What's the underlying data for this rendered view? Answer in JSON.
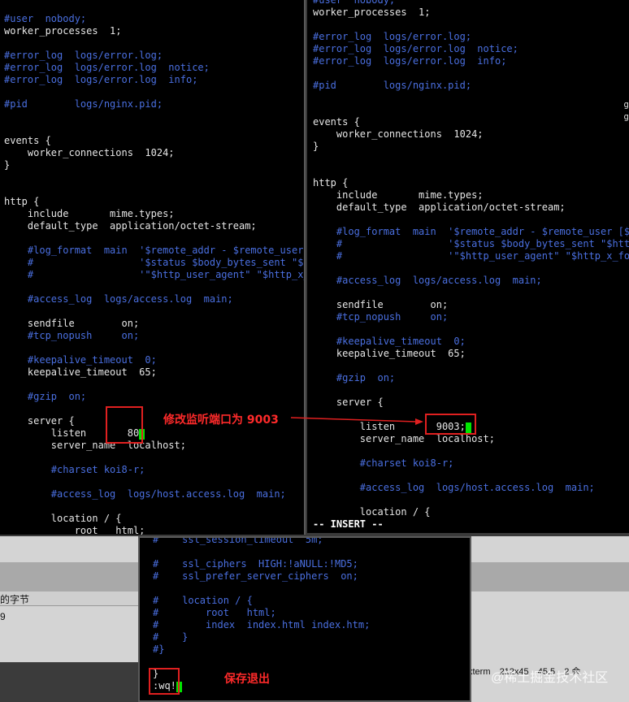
{
  "background": {
    "tab_label": "的字节",
    "tab_value": "9",
    "statusbar": [
      "xterm",
      "212x45",
      "45.5",
      "2 会"
    ],
    "watermark": "@稀土掘金技术社区"
  },
  "left_terminal": {
    "lines": [
      {
        "t": "#user  nobody;",
        "c": true
      },
      {
        "t": "worker_processes  1;"
      },
      {
        "t": ""
      },
      {
        "t": "#error_log  logs/error.log;",
        "c": true
      },
      {
        "t": "#error_log  logs/error.log  notice;",
        "c": true
      },
      {
        "t": "#error_log  logs/error.log  info;",
        "c": true
      },
      {
        "t": ""
      },
      {
        "t": "#pid        logs/nginx.pid;",
        "c": true
      },
      {
        "t": ""
      },
      {
        "t": ""
      },
      {
        "t": "events {"
      },
      {
        "t": "    worker_connections  1024;"
      },
      {
        "t": "}"
      },
      {
        "t": ""
      },
      {
        "t": ""
      },
      {
        "t": "http {"
      },
      {
        "t": "    include       mime.types;"
      },
      {
        "t": "    default_type  application/octet-stream;"
      },
      {
        "t": ""
      },
      {
        "t": "    #log_format  main  '$remote_addr - $remote_user [",
        "c": true
      },
      {
        "t": "    #                  '$status $body_bytes_sent \"$htt",
        "c": true
      },
      {
        "t": "    #                  '\"$http_user_agent\" \"$http_x_f",
        "c": true
      },
      {
        "t": ""
      },
      {
        "t": "    #access_log  logs/access.log  main;",
        "c": true
      },
      {
        "t": ""
      },
      {
        "t": "    sendfile        on;"
      },
      {
        "t": "    #tcp_nopush     on;",
        "c": true
      },
      {
        "t": ""
      },
      {
        "t": "    #keepalive_timeout  0;",
        "c": true
      },
      {
        "t": "    keepalive_timeout  65;"
      },
      {
        "t": ""
      },
      {
        "t": "    #gzip  on;",
        "c": true
      },
      {
        "t": ""
      },
      {
        "t": "    server {"
      },
      {
        "t": "        listen       80",
        "cursor": ";"
      },
      {
        "t": "        server_name  localhost;"
      },
      {
        "t": ""
      },
      {
        "t": "        #charset koi8-r;",
        "c": true
      },
      {
        "t": ""
      },
      {
        "t": "        #access_log  logs/host.access.log  main;",
        "c": true
      },
      {
        "t": ""
      },
      {
        "t": "        location / {"
      },
      {
        "t": "            root   html;"
      }
    ]
  },
  "right_terminal": {
    "lines": [
      {
        "t": "#user  nobody;",
        "c": true
      },
      {
        "t": "worker_processes  1;"
      },
      {
        "t": ""
      },
      {
        "t": "#error_log  logs/error.log;",
        "c": true
      },
      {
        "t": "#error_log  logs/error.log  notice;",
        "c": true
      },
      {
        "t": "#error_log  logs/error.log  info;",
        "c": true
      },
      {
        "t": ""
      },
      {
        "t": "#pid        logs/nginx.pid;",
        "c": true
      },
      {
        "t": ""
      },
      {
        "t": ""
      },
      {
        "t": "events {"
      },
      {
        "t": "    worker_connections  1024;"
      },
      {
        "t": "}"
      },
      {
        "t": ""
      },
      {
        "t": ""
      },
      {
        "t": "http {"
      },
      {
        "t": "    include       mime.types;"
      },
      {
        "t": "    default_type  application/octet-stream;"
      },
      {
        "t": ""
      },
      {
        "t": "    #log_format  main  '$remote_addr - $remote_user [$t",
        "c": true
      },
      {
        "t": "    #                  '$status $body_bytes_sent \"$http",
        "c": true
      },
      {
        "t": "    #                  '\"$http_user_agent\" \"$http_x_for",
        "c": true
      },
      {
        "t": ""
      },
      {
        "t": "    #access_log  logs/access.log  main;",
        "c": true
      },
      {
        "t": ""
      },
      {
        "t": "    sendfile        on;"
      },
      {
        "t": "    #tcp_nopush     on;",
        "c": true
      },
      {
        "t": ""
      },
      {
        "t": "    #keepalive_timeout  0;",
        "c": true
      },
      {
        "t": "    keepalive_timeout  65;"
      },
      {
        "t": ""
      },
      {
        "t": "    #gzip  on;",
        "c": true
      },
      {
        "t": ""
      },
      {
        "t": "    server {"
      },
      {
        "t": ""
      },
      {
        "t": "        listen       9003;",
        "cursor": " "
      },
      {
        "t": "        server_name  localhost;"
      },
      {
        "t": ""
      },
      {
        "t": "        #charset koi8-r;",
        "c": true
      },
      {
        "t": ""
      },
      {
        "t": "        #access_log  logs/host.access.log  main;",
        "c": true
      },
      {
        "t": ""
      },
      {
        "t": "        location / {"
      },
      {
        "t": "-- INSERT --",
        "status": true
      }
    ],
    "edge_glyph": "g"
  },
  "bottom_terminal": {
    "lines": [
      {
        "t": "#    ssl_session_timeout  5m;",
        "c": true
      },
      {
        "t": ""
      },
      {
        "t": "#    ssl_ciphers  HIGH:!aNULL:!MD5;",
        "c": true
      },
      {
        "t": "#    ssl_prefer_server_ciphers  on;",
        "c": true
      },
      {
        "t": ""
      },
      {
        "t": "#    location / {",
        "c": true
      },
      {
        "t": "#        root   html;",
        "c": true
      },
      {
        "t": "#        index  index.html index.htm;",
        "c": true
      },
      {
        "t": "#    }",
        "c": true
      },
      {
        "t": "#}",
        "c": true
      },
      {
        "t": ""
      },
      {
        "t": "}"
      },
      {
        "t": ":wq!",
        "cursor": " "
      }
    ]
  },
  "annotations": {
    "port_note": "修改监听端口为 9003",
    "save_note": "保存退出",
    "color": "#e02020"
  }
}
